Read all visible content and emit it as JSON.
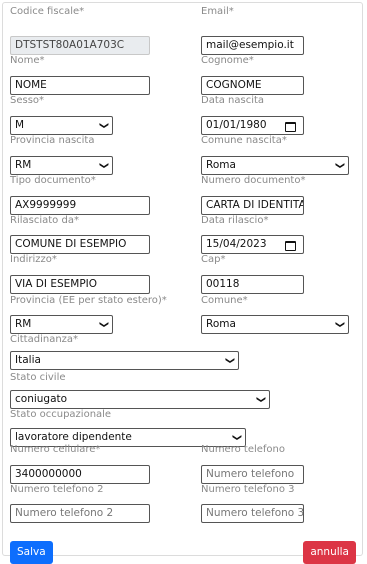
{
  "fields": {
    "codice_fiscale": {
      "label": "Codice fiscale*",
      "value": "DTSTST80A01A703C"
    },
    "email": {
      "label": "Email*",
      "value": "mail@esempio.it"
    },
    "nome": {
      "label": "Nome*",
      "value": "NOME"
    },
    "cognome": {
      "label": "Cognome*",
      "value": "COGNOME"
    },
    "sesso": {
      "label": "Sesso*",
      "value": "M"
    },
    "data_nascita": {
      "label": "Data nascita",
      "value": "01/01/1980"
    },
    "provincia_nascita": {
      "label": "Provincia nascita",
      "value": "RM"
    },
    "comune_nascita": {
      "label": "Comune nascita*",
      "value": "Roma"
    },
    "tipo_documento": {
      "label": "Tipo documento*",
      "value": "AX9999999"
    },
    "numero_documento": {
      "label": "Numero documento*",
      "value": "CARTA DI IDENTITA"
    },
    "rilasciato_da": {
      "label": "Rilasciato da*",
      "value": "COMUNE DI ESEMPIO"
    },
    "data_rilascio": {
      "label": "Data rilascio*",
      "value": "15/04/2023"
    },
    "indirizzo": {
      "label": "Indirizzo*",
      "value": "VIA DI ESEMPIO"
    },
    "cap": {
      "label": "Cap*",
      "value": "00118"
    },
    "provincia": {
      "label": "Provincia (EE per stato estero)*",
      "value": "RM"
    },
    "comune": {
      "label": "Comune*",
      "value": "Roma"
    },
    "cittadinanza": {
      "label": "Cittadinanza*",
      "value": "Italia"
    },
    "stato_civile": {
      "label": "Stato civile",
      "value": "coniugato"
    },
    "stato_occupazionale": {
      "label": "Stato occupazionale",
      "value": "lavoratore dipendente"
    },
    "numero_cellulare": {
      "label": "Numero cellulare*",
      "value": "3400000000"
    },
    "numero_telefono": {
      "label": "Numero telefono",
      "placeholder": "Numero telefono"
    },
    "numero_telefono_2": {
      "label": "Numero telefono 2",
      "placeholder": "Numero telefono 2"
    },
    "numero_telefono_3": {
      "label": "Numero telefono 3",
      "placeholder": "Numero telefono 3"
    }
  },
  "icons": {
    "select_arrow": "chevron-down-icon",
    "date_picker": "calendar-icon"
  },
  "buttons": {
    "salva": "Salva",
    "annulla": "annulla"
  },
  "colors": {
    "salva": "#0d6efd",
    "annulla": "#dc3545"
  }
}
